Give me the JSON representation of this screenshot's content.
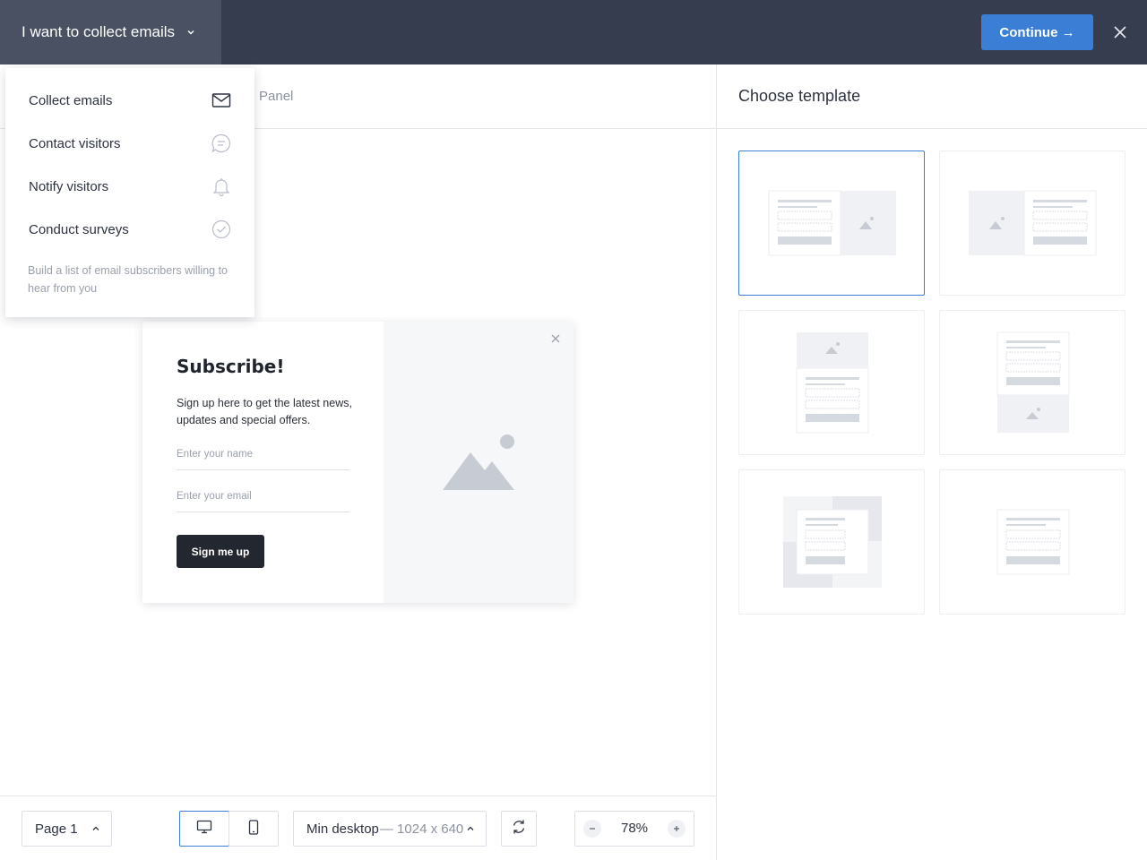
{
  "header": {
    "goal_label": "I want to collect emails",
    "continue_label": "Continue →"
  },
  "dropdown": {
    "items": [
      {
        "label": "Collect emails",
        "icon": "envelope-icon"
      },
      {
        "label": "Contact visitors",
        "icon": "chat-bubble-icon"
      },
      {
        "label": "Notify visitors",
        "icon": "bell-icon"
      },
      {
        "label": "Conduct surveys",
        "icon": "check-circle-icon"
      }
    ],
    "description": "Build a list of email subscribers willing to hear from you"
  },
  "editor": {
    "tab_partial_label": "Panel"
  },
  "popup": {
    "title": "Subscribe!",
    "description": "Sign up here to get the latest news, updates and special offers.",
    "name_placeholder": "Enter your name",
    "email_placeholder": "Enter your email",
    "button_label": "Sign me up"
  },
  "right_panel": {
    "title": "Choose template",
    "templates": [
      {
        "layout": "form-left-image-right",
        "selected": true
      },
      {
        "layout": "image-left-form-right",
        "selected": false
      },
      {
        "layout": "image-top-form-bottom",
        "selected": false
      },
      {
        "layout": "form-top-image-bottom",
        "selected": false
      },
      {
        "layout": "form-over-background",
        "selected": false
      },
      {
        "layout": "form-only",
        "selected": false
      }
    ]
  },
  "bottom_bar": {
    "page_label": "Page 1",
    "resolution_label": "Min desktop",
    "resolution_dims": "— 1024 x 640",
    "zoom": "78%"
  },
  "colors": {
    "topbar": "#363d4f",
    "accent": "#3a7fd5",
    "popup_button": "#23272f"
  }
}
